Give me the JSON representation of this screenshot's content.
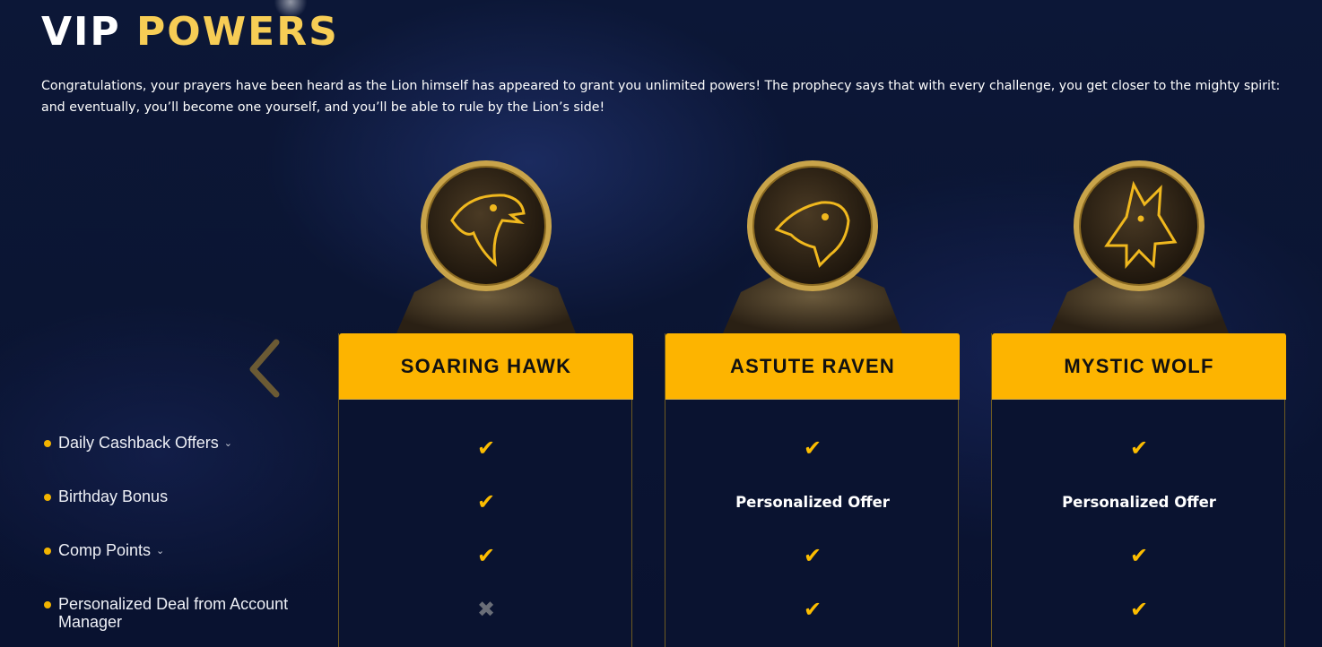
{
  "header": {
    "title_part1": "VIP",
    "title_part2": "POWERS",
    "intro": "Congratulations, your prayers have been heard as the Lion himself has appeared to grant you unlimited powers! The prophecy says that with every challenge, you get closer to the mighty spirit: and eventually, you’ll become one yourself, and you’ll be able to rule by the Lion’s side!"
  },
  "colors": {
    "background": "#0b1533",
    "accent_gold": "#fdb400",
    "title_gold": "#f7cd55",
    "check": "#fcbd00",
    "cross": "#6a6e78"
  },
  "navigation": {
    "prev_icon": "chevron-left-icon"
  },
  "features": [
    {
      "label": "Daily Cashback Offers",
      "expandable": true,
      "expand_icon": "⌄"
    },
    {
      "label": "Birthday Bonus",
      "expandable": false,
      "expand_icon": ""
    },
    {
      "label": "Comp Points",
      "expandable": true,
      "expand_icon": "⌄"
    },
    {
      "label": "Personalized Deal from Account Manager",
      "expandable": false,
      "expand_icon": ""
    }
  ],
  "tiers": [
    {
      "name": "SOARING HAWK",
      "medal_icon": "hawk-medal-icon",
      "cells": [
        {
          "type": "check",
          "text": "✔"
        },
        {
          "type": "check",
          "text": "✔"
        },
        {
          "type": "check",
          "text": "✔"
        },
        {
          "type": "cross",
          "text": "✖"
        }
      ]
    },
    {
      "name": "ASTUTE RAVEN",
      "medal_icon": "raven-medal-icon",
      "cells": [
        {
          "type": "check",
          "text": "✔"
        },
        {
          "type": "text",
          "text": "Personalized Offer"
        },
        {
          "type": "check",
          "text": "✔"
        },
        {
          "type": "check",
          "text": "✔"
        }
      ]
    },
    {
      "name": "MYSTIC WOLF",
      "medal_icon": "wolf-medal-icon",
      "cells": [
        {
          "type": "check",
          "text": "✔"
        },
        {
          "type": "text",
          "text": "Personalized Offer"
        },
        {
          "type": "check",
          "text": "✔"
        },
        {
          "type": "check",
          "text": "✔"
        }
      ]
    }
  ]
}
